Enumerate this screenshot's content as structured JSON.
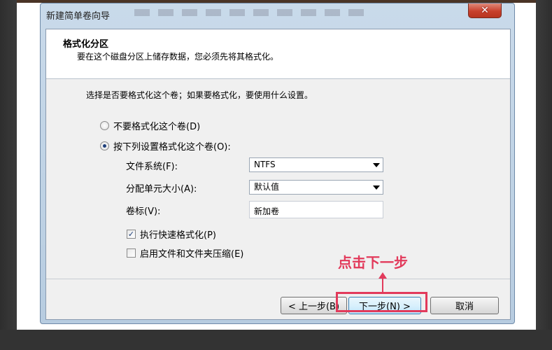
{
  "window": {
    "title": "新建简单卷向导",
    "close_glyph": "✕"
  },
  "header": {
    "title": "格式化分区",
    "subtitle": "要在这个磁盘分区上储存数据，您必须先将其格式化。"
  },
  "main": {
    "question": "选择是否要格式化这个卷；如果要格式化，要使用什么设置。",
    "radio_no_format": "不要格式化这个卷(D)",
    "radio_format": "按下列设置格式化这个卷(O):",
    "fs_label": "文件系统(F):",
    "fs_value": "NTFS",
    "alloc_label": "分配单元大小(A):",
    "alloc_value": "默认值",
    "vol_label": "卷标(V):",
    "vol_value": "新加卷",
    "quick_format": "执行快速格式化(P)",
    "compress": "启用文件和文件夹压缩(E)",
    "quick_format_checked": true,
    "compress_checked": false,
    "selected_radio": "format"
  },
  "buttons": {
    "back": "< 上一步(B)",
    "next": "下一步(N) >",
    "cancel": "取消"
  },
  "annotation": {
    "text": "点击下一步",
    "color": "#e23a5b"
  }
}
